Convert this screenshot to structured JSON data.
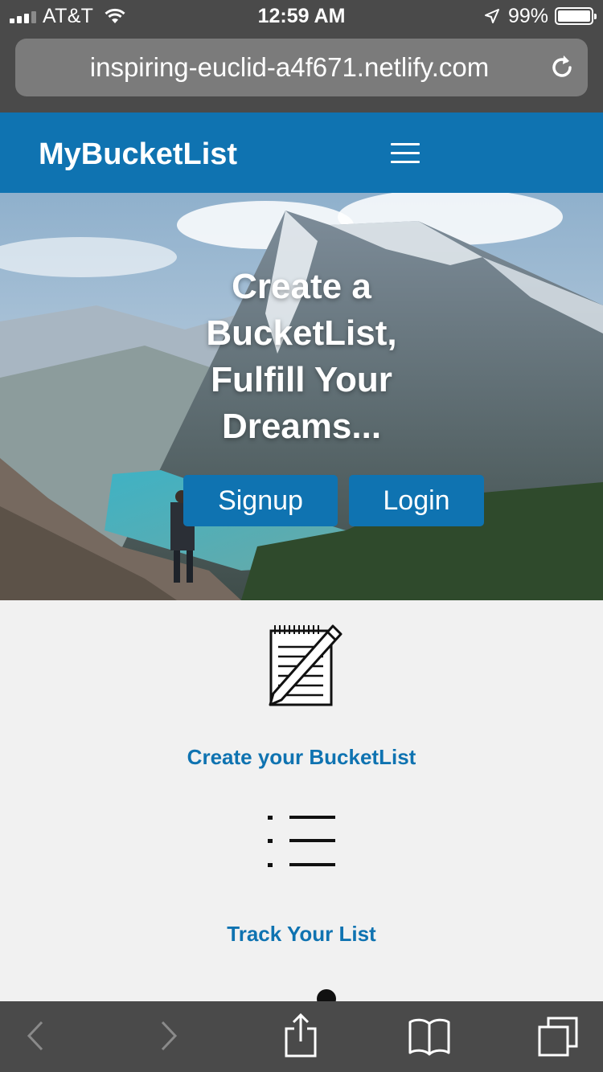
{
  "status_bar": {
    "carrier": "AT&T",
    "time": "12:59 AM",
    "battery": "99%",
    "battery_level": 0.99
  },
  "browser": {
    "url": "inspiring-euclid-a4f671.netlify.com"
  },
  "navbar": {
    "brand": "MyBucketList"
  },
  "hero": {
    "title": "Create a BucketList, Fulfill Your Dreams...",
    "signup_label": "Signup",
    "login_label": "Login"
  },
  "features": [
    {
      "title": "Create your BucketList",
      "icon": "notepad-pen-icon"
    },
    {
      "title": "Track Your List",
      "icon": "list-icon"
    }
  ],
  "colors": {
    "brand": "#0f73b1",
    "chrome": "#4a4a4a",
    "page_bg": "#f1f1f1"
  }
}
